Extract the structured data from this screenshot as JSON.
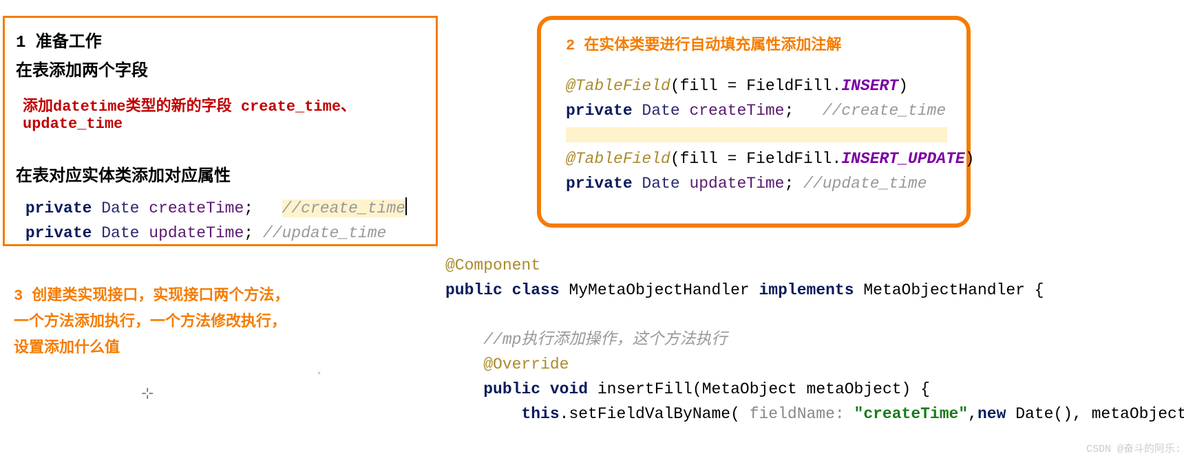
{
  "box1": {
    "title": "1 准备工作",
    "subtitle": "在表添加两个字段",
    "red_note": "添加datetime类型的新的字段 create_time、update_time",
    "title2": "在表对应实体类添加对应属性",
    "line1_kw": "private",
    "line1_cls": " Date ",
    "line1_field": "createTime",
    "line1_semi": ";   ",
    "line1_com": "//create_time",
    "line2_kw": "private",
    "line2_cls": " Date ",
    "line2_field": "updateTime",
    "line2_semi": "; ",
    "line2_com": "//update_time"
  },
  "box2": {
    "title": "2 在实体类要进行自动填充属性添加注解",
    "a1_ann": "@TableField",
    "a1_paren": "(fill = FieldFill.",
    "a1_enum": "INSERT",
    "a1_close": ")",
    "a2_kw": "private",
    "a2_cls": " Date ",
    "a2_field": "createTime",
    "a2_semi": ";   ",
    "a2_com": "//create_time",
    "b1_ann": "@TableField",
    "b1_paren": "(fill = FieldFill.",
    "b1_enum": "INSERT_UPDATE",
    "b1_close": ")",
    "b2_kw": "private",
    "b2_cls": " Date ",
    "b2_field": "updateTime",
    "b2_semi": "; ",
    "b2_com": "//update_time"
  },
  "step3": {
    "l1": "3 创建类实现接口，实现接口两个方法，",
    "l2": "一个方法添加执行，一个方法修改执行，",
    "l3": "设置添加什么值"
  },
  "code3": {
    "l1_ann": "@Component",
    "l2_kw1": "public",
    "l2_kw2": " class ",
    "l2_name": "MyMetaObjectHandler ",
    "l2_impl": "implements",
    "l2_rest": " MetaObjectHandler {",
    "l3_com": "    //mp执行添加操作，这个方法执行",
    "l4_ann": "    @Override",
    "l5_pre": "    ",
    "l5_kw1": "public",
    "l5_kw2": " void ",
    "l5_name": "insertFill",
    "l5_rest": "(MetaObject metaObject) {",
    "l6_pre": "        ",
    "l6_this": "this",
    "l6_dot": ".setFieldValByName( ",
    "l6_param": "fieldName: ",
    "l6_str": "\"createTime\"",
    "l6_mid": ",",
    "l6_new": "new",
    "l6_rest2": " Date(), metaObject);"
  },
  "watermark": "CSDN @奋斗的阿乐:",
  "marks": {
    "cursor": "⊹",
    "small": "▫"
  }
}
